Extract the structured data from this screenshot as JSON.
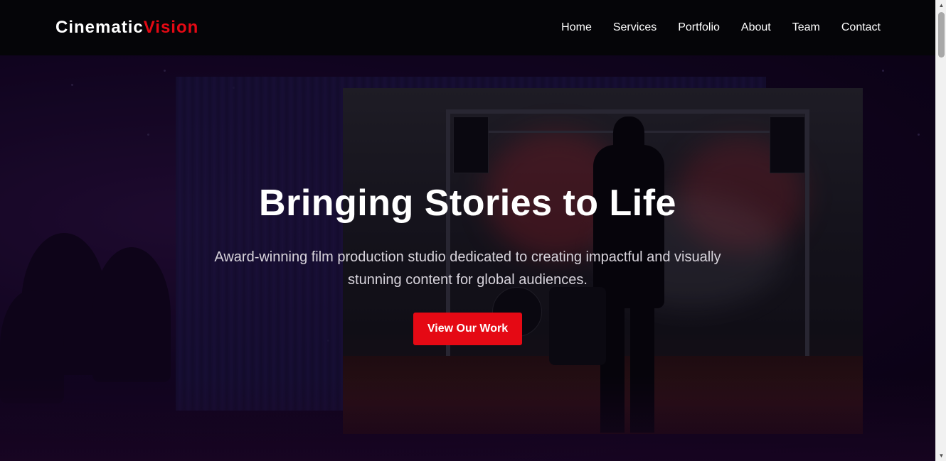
{
  "brand": {
    "name_part1": "Cinematic",
    "name_part2": "Vision",
    "accent_color": "#e50914"
  },
  "nav": {
    "items": [
      {
        "label": "Home"
      },
      {
        "label": "Services"
      },
      {
        "label": "Portfolio"
      },
      {
        "label": "About"
      },
      {
        "label": "Team"
      },
      {
        "label": "Contact"
      }
    ]
  },
  "hero": {
    "title": "Bringing Stories to Life",
    "subtitle": "Award-winning film production studio dedicated to creating impactful and visually stunning content for global audiences.",
    "cta_label": "View Our Work"
  },
  "scrollbar": {
    "up_icon": "▲",
    "down_icon": "▼"
  }
}
